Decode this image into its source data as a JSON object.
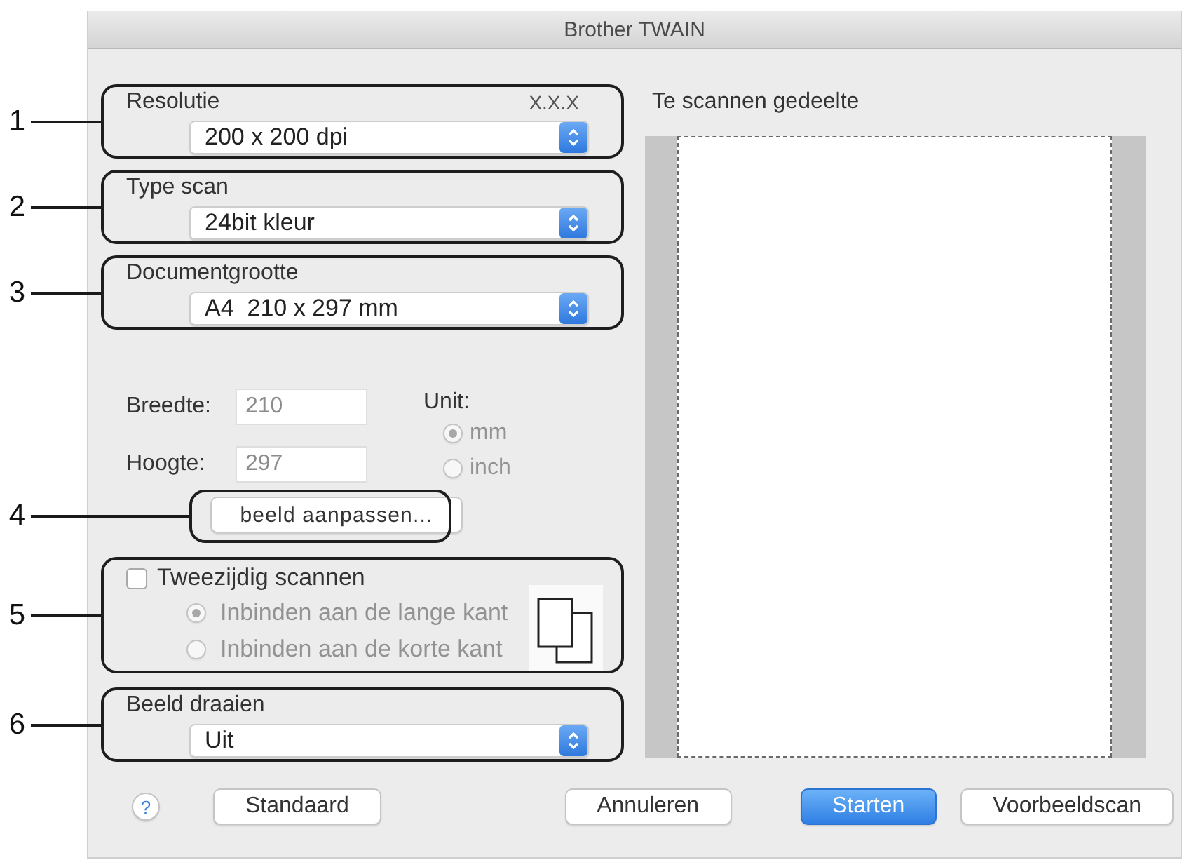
{
  "window": {
    "title": "Brother TWAIN"
  },
  "resolution": {
    "callout": "1",
    "label": "Resolutie",
    "version": "X.X.X",
    "value": "200 x 200 dpi"
  },
  "scan_type": {
    "callout": "2",
    "label": "Type scan",
    "value": "24bit kleur"
  },
  "document_size": {
    "callout": "3",
    "label": "Documentgrootte",
    "value": "A4  210 x 297 mm"
  },
  "dimensions": {
    "fields": [
      {
        "label": "Breedte:",
        "value": "210",
        "disabled": true
      },
      {
        "label": "Hoogte:",
        "value": "297",
        "disabled": true
      }
    ],
    "unit": {
      "label": "Unit:",
      "options": [
        {
          "label": "mm",
          "selected": true,
          "disabled": true
        },
        {
          "label": "inch",
          "selected": false,
          "disabled": true
        }
      ]
    }
  },
  "adjust_button": {
    "callout": "4",
    "label": "beeld aanpassen..."
  },
  "duplex": {
    "callout": "5",
    "label": "Tweezijdig scannen",
    "checked": false,
    "options": [
      {
        "label": "Inbinden aan de lange kant",
        "selected": true,
        "disabled": true
      },
      {
        "label": "Inbinden aan de korte kant",
        "selected": false,
        "disabled": true
      }
    ]
  },
  "rotation": {
    "callout": "6",
    "label": "Beeld draaien",
    "value": "Uit"
  },
  "preview": {
    "label": "Te scannen gedeelte"
  },
  "footer": {
    "help": "?",
    "left_buttons": [
      {
        "label": "Standaard",
        "kind": "default"
      }
    ],
    "right_buttons": [
      {
        "label": "Annuleren",
        "kind": "default"
      },
      {
        "label": "Starten",
        "kind": "primary"
      },
      {
        "label": "Voorbeeldscan",
        "kind": "default"
      }
    ]
  }
}
